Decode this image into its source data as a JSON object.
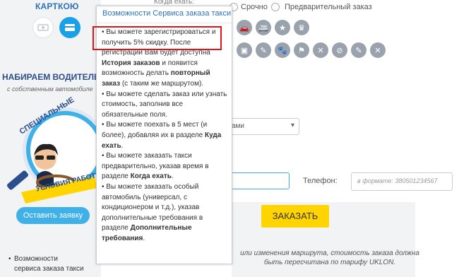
{
  "sidebar": {
    "card_title": "КАРТКОЮ",
    "hiring_title": "НАБИРАЕМ ВОДИТЕЛЕ",
    "hiring_sub": "с собственным автомобиле",
    "badge_top": "СПЕЦИАЛЬНЫЕ",
    "badge_bottom": "УСЛОВИЯ РАБОТЫ",
    "apply_button": "Оставить заявку",
    "list_item": "Возможности сервиса заказа такси"
  },
  "form": {
    "top_label": "Когда ехать:",
    "urgent_label": "Срочно",
    "pre_label": "Предварительный заказ",
    "payment_select_text": "ами",
    "phone_label": "Телефон:",
    "phone_placeholder": "в формате: 380501234567",
    "order_button": "ЗАКАЗАТЬ",
    "note_line1": "или изменения маршрута, стоимость заказа должна",
    "note_line2": "быть пересчитана по тарифу UKLON."
  },
  "popup": {
    "title": "Возможности Сервиса заказа такси",
    "items": [
      {
        "pre": "• Вы можете зарегистрироваться и получить 5% скидку. После регистрации Вам будет доступна ",
        "bold1": "История заказов",
        "mid": " и появится возможность делать ",
        "bold2": "повторный заказ",
        "post": " (с таким же маршрутом)."
      },
      {
        "pre": "• Вы можете сделать заказ или узнать стоимость, заполнив все обязательные поля.",
        "bold1": "",
        "mid": "",
        "bold2": "",
        "post": ""
      },
      {
        "pre": "• Вы можете поехать в 5 мест (и более), добавляя их в разделе ",
        "bold1": "Куда ехать",
        "mid": ".",
        "bold2": "",
        "post": ""
      },
      {
        "pre": "• Вы можете заказать такси предварительно, указав время в разделе ",
        "bold1": "Когда ехать",
        "mid": ".",
        "bold2": "",
        "post": ""
      },
      {
        "pre": "• Вы можете заказать особый автомобиль (универсал, с кондиционером и т.д.), указав дополнительные требования в разделе ",
        "bold1": "Дополнительные требования",
        "mid": ".",
        "bold2": "",
        "post": ""
      }
    ]
  },
  "colors": {
    "accent": "#2e72b8",
    "button_blue": "#3fb0e8",
    "order_yellow": "#ffd400",
    "highlight_red": "#e0151c"
  },
  "icons": [
    "car-icon",
    "van-icon",
    "star-icon",
    "crown-icon",
    "luggage-icon",
    "smoking-icon",
    "pet-icon",
    "flag-icon",
    "no-smoking-icon",
    "pen-icon",
    "mute-icon"
  ]
}
